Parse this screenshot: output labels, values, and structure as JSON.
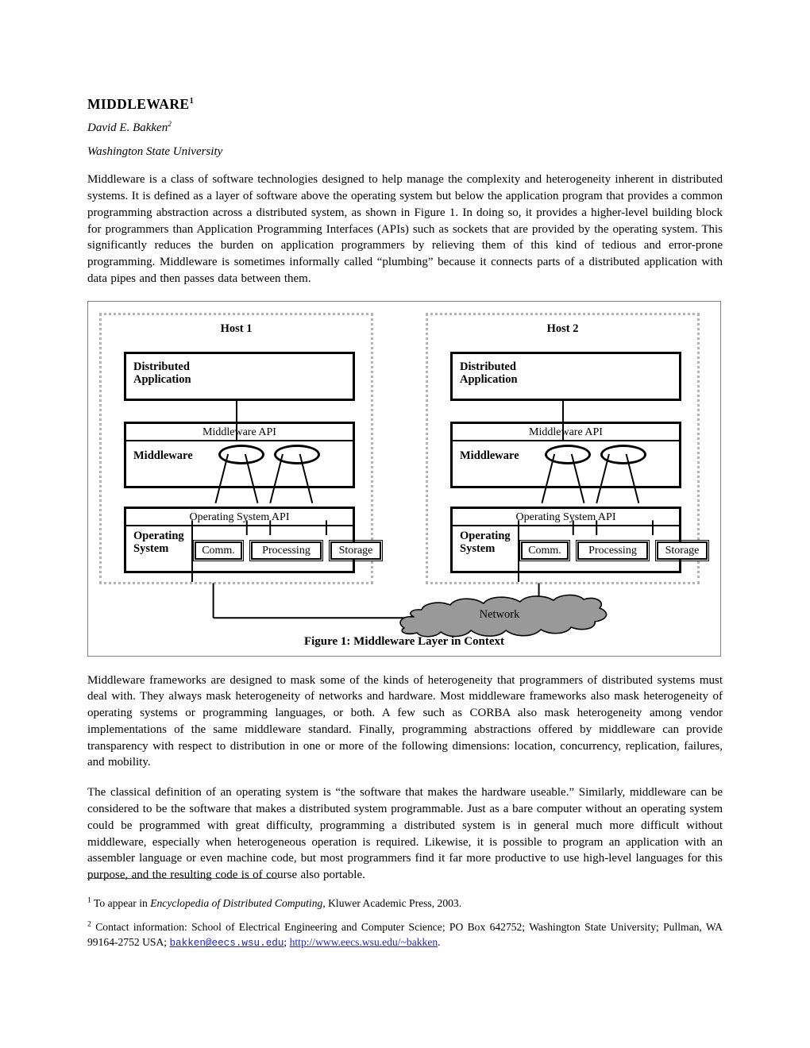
{
  "document": {
    "title": "MIDDLEWARE",
    "title_footnote_mark": "1",
    "author": "David E. Bakken",
    "author_footnote_mark": "2",
    "affiliation": "Washington State University"
  },
  "paragraphs": {
    "intro": "Middleware is a class of software technologies designed to help manage the complexity and heterogeneity inherent in distributed systems.  It is defined as a layer of software above the operating system but below the application program that provides a common programming abstraction across a distributed system, as shown in Figure 1.  In doing so, it provides a higher-level building block for programmers than Application Programming Interfaces (APIs) such as sockets that are provided by the operating system.  This significantly reduces the burden on application programmers by relieving them of this kind of tedious and error-prone programming.  Middleware is sometimes informally called “plumbing” because it connects parts of a distributed application with data pipes and then passes data between them.",
    "frameworks": "Middleware frameworks are designed to mask some of the kinds of heterogeneity that programmers of distributed systems must deal with.  They always mask heterogeneity of networks and hardware.  Most middleware frameworks also mask heterogeneity of operating systems or programming languages, or both.  A few such as CORBA also mask heterogeneity among vendor implementations of the same middleware standard.  Finally, programming abstractions offered by middleware can provide transparency with respect to distribution in one or more of the following dimensions: location, concurrency, replication, failures, and mobility.",
    "classical": "The classical definition of an operating system is “the software that makes the hardware useable.”  Similarly, middleware can be considered to be the software that makes a distributed system programmable.  Just as a bare computer without an operating system could be programmed with great difficulty, programming a distributed system is in general much more difficult without middleware, especially when heterogeneous operation is required.  Likewise, it is possible to program an application with an assembler language or even machine code, but most programmers find it far more productive to use high-level languages for this purpose, and the resulting code is of course also portable."
  },
  "figure": {
    "caption": "Figure 1: Middleware Layer in Context",
    "network_label": "Network",
    "colors": {
      "cloud_fill": "#999999",
      "cloud_stroke": "#000000",
      "host_border": "#b3b3b3",
      "figure_border": "#808080"
    },
    "hosts": [
      {
        "title": "Host 1",
        "application_label": "Distributed\nApplication",
        "middleware_api_label": "Middleware API",
        "middleware_label": "Middleware",
        "os_api_label": "Operating System API",
        "os_label": "Operating\nSystem",
        "os_components": [
          "Comm.",
          "Processing",
          "Storage"
        ]
      },
      {
        "title": "Host 2",
        "application_label": "Distributed\nApplication",
        "middleware_api_label": "Middleware API",
        "middleware_label": "Middleware",
        "os_api_label": "Operating System API",
        "os_label": "Operating\nSystem",
        "os_components": [
          "Comm.",
          "Processing",
          "Storage"
        ]
      }
    ]
  },
  "footnotes": {
    "one": {
      "mark": "1",
      "before": "To appear in ",
      "italic": "Encyclopedia of Distributed Computing",
      "after": ", Kluwer Academic Press, 2003."
    },
    "two": {
      "mark": "2",
      "before": "Contact information: School of Electrical Engineering and Computer Science; PO Box 642752; Washington State University; Pullman, WA 99164-2752 USA; ",
      "email": "bakken@eecs.wsu.edu",
      "middle": "; ",
      "url": "http://www.eecs.wsu.edu/~bakken",
      "after": "."
    }
  }
}
